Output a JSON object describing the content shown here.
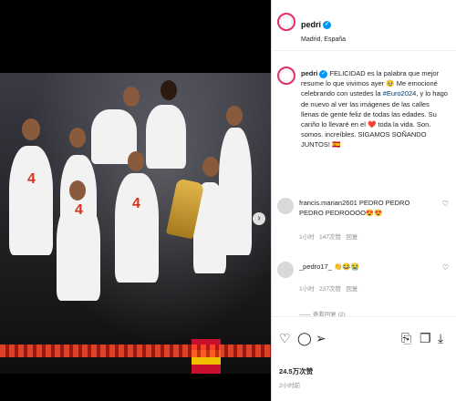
{
  "media": {
    "jersey_number": "4",
    "next_glyph": "›"
  },
  "header": {
    "username": "pedri",
    "location": "Madrid, España"
  },
  "caption": {
    "username": "pedri",
    "part1": "FELICIDAD es la palabra que mejor resume lo que vivimos ayer 🥹 Me emocioné celebrando con ustedes la ",
    "hashtag": "#Euro2024",
    "part2": ", y lo hago de nuevo al ver las imágenes de las calles llenas de gente feliz de todas las edades. Su cariño lo llevaré en el ❤️ toda la vida. Son. somos. increíbles. SIGAMOS SOÑANDO JUNTOS! 🇪🇸"
  },
  "comments": [
    {
      "text": "francis.marian2601 PEDRO PEDRO PEDRO PEDROOOO😍😍",
      "time": "1小时",
      "likes": "147次赞",
      "reply": "回复"
    },
    {
      "text": "_pedro17_ 👏😂😭",
      "time": "1小时",
      "likes": "237次赞",
      "reply": "回复"
    }
  ],
  "more_replies": "—— 查看回复 (2)",
  "actions": {
    "like_icon": "heart-outline",
    "comment_icon": "comment-bubble",
    "share_icon": "paper-plane",
    "save_icon": "bookmark",
    "copy_icon": "copy",
    "download_icon": "download"
  },
  "likes_count": "24.5万次赞",
  "posted_ago": "2小时前"
}
